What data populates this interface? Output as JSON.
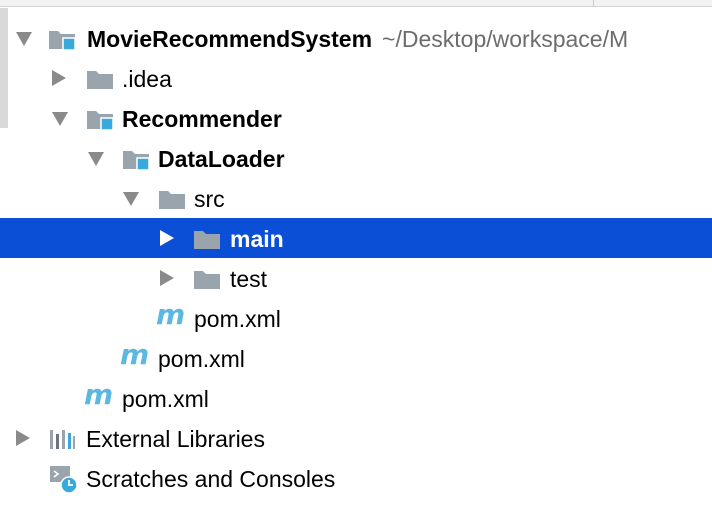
{
  "tree": {
    "root": {
      "name": "MovieRecommendSystem",
      "path": "~/Desktop/workspace/M"
    },
    "idea": {
      "name": ".idea"
    },
    "recommender": {
      "name": "Recommender"
    },
    "dataloader": {
      "name": "DataLoader"
    },
    "src": {
      "name": "src"
    },
    "main": {
      "name": "main"
    },
    "test": {
      "name": "test"
    },
    "dataloader_pom": {
      "name": "pom.xml"
    },
    "recommender_pom": {
      "name": "pom.xml"
    },
    "root_pom": {
      "name": "pom.xml"
    },
    "external_libraries": {
      "name": "External Libraries"
    },
    "scratches": {
      "name": "Scratches and Consoles"
    }
  },
  "icons": {
    "folder": "folder-icon",
    "module_folder": "module-folder-icon",
    "maven": "maven-icon",
    "libraries": "libraries-icon",
    "scratches": "scratches-icon"
  },
  "colors": {
    "selection": "#0b4fd6",
    "folder": "#9aa4ad",
    "module_badge": "#39a8db",
    "maven": "#5cb8e0",
    "path": "#6d6d6d"
  }
}
